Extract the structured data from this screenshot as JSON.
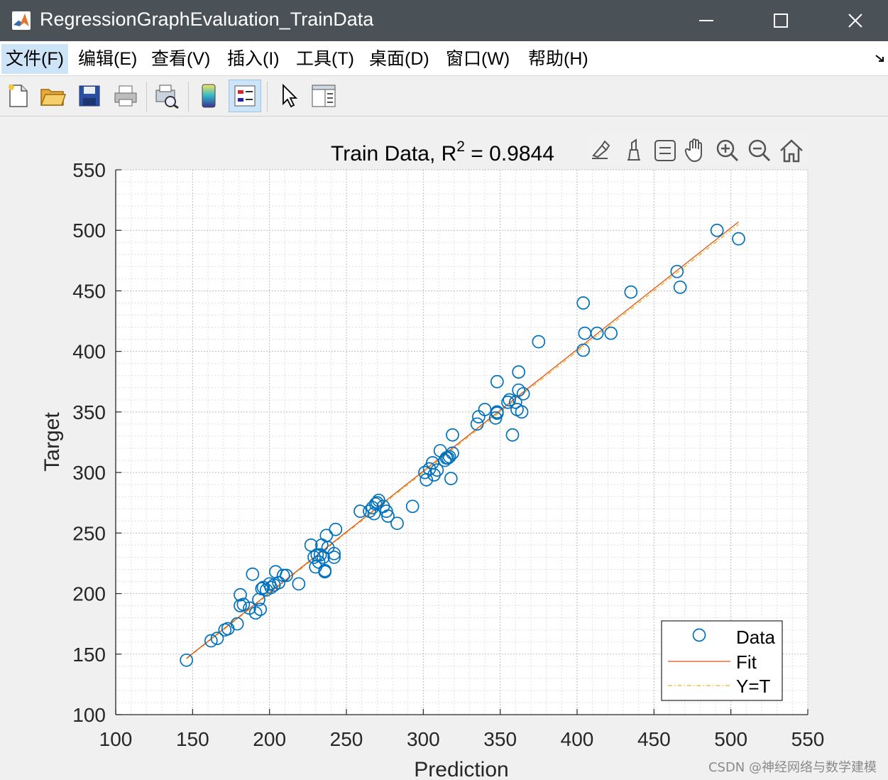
{
  "window": {
    "title": "RegressionGraphEvaluation_TrainData"
  },
  "menu": [
    "文件(F)",
    "编辑(E)",
    "查看(V)",
    "插入(I)",
    "工具(T)",
    "桌面(D)",
    "窗口(W)",
    "帮助(H)"
  ],
  "toolbar_icons": [
    "new-file-icon",
    "open-folder-icon",
    "save-icon",
    "print-icon",
    "print-preview-icon",
    "colorbar-icon",
    "legend-icon",
    "pointer-icon",
    "property-inspector-icon"
  ],
  "axes_toolbar_icons": [
    "brush-icon",
    "data-tips-icon",
    "restore-view-icon",
    "pan-icon",
    "zoom-in-icon",
    "zoom-out-icon",
    "home-icon"
  ],
  "watermark": "CSDN @神经网络与数学建模",
  "colors": {
    "data": "#0072bd",
    "fit": "#d95319",
    "ident": "#edb120"
  },
  "chart_data": {
    "type": "scatter",
    "title_prefix": "Train Data, R",
    "title_sup": "2",
    "title_suffix": " = 0.9844",
    "xlabel": "Prediction",
    "ylabel": "Target",
    "xlim": [
      100,
      550
    ],
    "ylim": [
      100,
      550
    ],
    "xticks": [
      100,
      150,
      200,
      250,
      300,
      350,
      400,
      450,
      500,
      550
    ],
    "yticks": [
      100,
      150,
      200,
      250,
      300,
      350,
      400,
      450,
      500,
      550
    ],
    "grid": true,
    "minor_grid": true,
    "legend": {
      "position": "bottom-right",
      "entries": [
        "Data",
        "Fit",
        "Y=T"
      ]
    },
    "series": [
      {
        "name": "Data",
        "mode": "markers",
        "x": [
          146,
          162,
          166,
          171,
          173,
          179,
          181,
          181,
          183,
          187,
          189,
          191,
          193,
          194,
          195,
          196,
          198,
          200,
          201,
          203,
          204,
          206,
          209,
          211,
          219,
          227,
          229,
          230,
          231,
          232,
          233,
          234,
          235,
          236,
          236,
          237,
          238,
          242,
          242,
          243,
          259,
          265,
          267,
          268,
          269,
          270,
          271,
          274,
          276,
          277,
          283,
          293,
          301,
          302,
          304,
          306,
          307,
          309,
          311,
          314,
          315,
          316,
          317,
          318,
          319,
          319,
          335,
          336,
          340,
          347,
          348,
          348,
          348,
          355,
          356,
          358,
          360,
          361,
          362,
          362,
          364,
          365,
          375,
          404,
          404,
          405,
          413,
          422,
          435,
          465,
          467,
          491,
          505
        ],
        "y": [
          145,
          161,
          163,
          170,
          171,
          175,
          199,
          190,
          191,
          188,
          216,
          184,
          195,
          187,
          204,
          205,
          203,
          208,
          205,
          207,
          218,
          209,
          215,
          215,
          208,
          240,
          230,
          222,
          232,
          226,
          232,
          240,
          230,
          218,
          219,
          248,
          238,
          233,
          230,
          253,
          268,
          268,
          271,
          266,
          274,
          275,
          277,
          272,
          268,
          264,
          258,
          272,
          300,
          294,
          303,
          308,
          298,
          302,
          318,
          310,
          312,
          312,
          313,
          295,
          331,
          316,
          340,
          346,
          352,
          345,
          375,
          350,
          349,
          358,
          360,
          331,
          358,
          352,
          368,
          383,
          350,
          365,
          408,
          440,
          401,
          415,
          415,
          415,
          449,
          466,
          453,
          500,
          493
        ]
      },
      {
        "name": "Fit",
        "mode": "line",
        "x": [
          146,
          505
        ],
        "y": [
          146.5,
          507
        ]
      },
      {
        "name": "Y=T",
        "mode": "line",
        "x": [
          146,
          505
        ],
        "y": [
          146,
          505
        ]
      }
    ]
  }
}
